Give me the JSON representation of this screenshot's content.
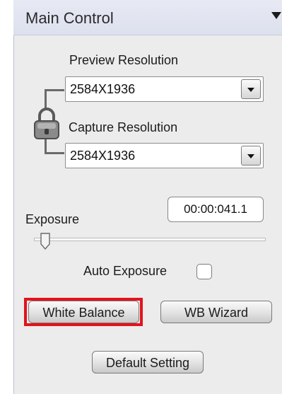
{
  "header": {
    "title": "Main Control",
    "collapse_icon": "triangle-down-icon"
  },
  "preview": {
    "label": "Preview Resolution",
    "value": "2584X1936"
  },
  "capture": {
    "label": "Capture Resolution",
    "value": "2584X1936"
  },
  "lock": {
    "icon": "padlock-icon"
  },
  "exposure": {
    "label": "Exposure",
    "time": "00:00:041.1",
    "slider_level": 0.03
  },
  "auto_exposure": {
    "label": "Auto Exposure",
    "checked": false
  },
  "buttons": {
    "white_balance": "White Balance",
    "wb_wizard": "WB Wizard",
    "default_setting": "Default Setting"
  },
  "colors": {
    "highlight": "#e3121b",
    "header_bg": "#e2e5f1",
    "panel_bg": "#ececec"
  }
}
